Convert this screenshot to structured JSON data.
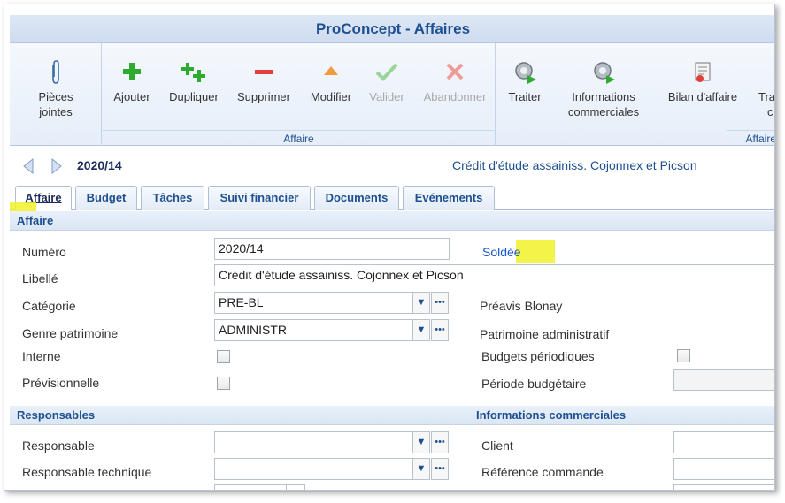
{
  "window": {
    "title": "ProConcept - Affaires"
  },
  "ribbon": {
    "attachments": {
      "label_line1": "Pièces",
      "label_line2": "jointes"
    },
    "group_affaire": {
      "label": "Affaire",
      "buttons": [
        {
          "label": "Ajouter",
          "icon": "plus-icon",
          "enabled": true
        },
        {
          "label": "Dupliquer",
          "icon": "duplicate-icon",
          "enabled": true
        },
        {
          "label": "Supprimer",
          "icon": "minus-icon",
          "enabled": true
        },
        {
          "label": "Modifier",
          "icon": "modify-icon",
          "enabled": true
        },
        {
          "label": "Valider",
          "icon": "check-icon",
          "enabled": false
        },
        {
          "label": "Abandonner",
          "icon": "x-icon",
          "enabled": false
        }
      ]
    },
    "group_affaire2": {
      "label": "Affaire",
      "buttons": [
        {
          "label": "Traiter",
          "icon": "process-gear-icon"
        },
        {
          "label_line1": "Informations",
          "label_line2": "commerciales",
          "icon": "info-gear-icon"
        },
        {
          "label": "Bilan d'affaire",
          "icon": "report-icon"
        },
        {
          "label_line1": "Tra",
          "label_line2": "c",
          "icon": "truncated-icon"
        }
      ]
    }
  },
  "record": {
    "number": "2020/14",
    "title": "Crédit d'étude assainiss. Cojonnex et Picson"
  },
  "tabs": [
    "Affaire",
    "Budget",
    "Tâches",
    "Suivi financier",
    "Documents",
    "Evénements"
  ],
  "section_affaire": {
    "header": "Affaire",
    "numero": {
      "label": "Numéro",
      "value": "2020/14",
      "status": "Soldée"
    },
    "libelle": {
      "label": "Libellé",
      "value": "Crédit d'étude assainiss. Cojonnex et Picson"
    },
    "categorie": {
      "label": "Catégorie",
      "value": "PRE-BL",
      "description": "Préavis Blonay"
    },
    "genre": {
      "label": "Genre patrimoine",
      "value": "ADMINISTR",
      "description": "Patrimoine administratif"
    },
    "interne": {
      "label": "Interne",
      "checked": false
    },
    "budgets_periodiques": {
      "label": "Budgets périodiques",
      "checked": false
    },
    "previsionnelle": {
      "label": "Prévisionnelle",
      "checked": false
    },
    "periode_budgetaire": {
      "label": "Période budgétaire",
      "value": ""
    }
  },
  "section_responsables": {
    "header": "Responsables",
    "responsable": {
      "label": "Responsable",
      "value": ""
    },
    "responsable_technique": {
      "label": "Responsable technique",
      "value": ""
    }
  },
  "section_info_commerciales": {
    "header": "Informations commerciales",
    "client": {
      "label": "Client",
      "value": ""
    },
    "reference_commande": {
      "label": "Référence commande",
      "value": ""
    }
  },
  "colors": {
    "accent": "#1d4f91",
    "highlight": "#f1f229",
    "link": "#1a57c8",
    "add_green": "#2eaa2e",
    "delete_red": "#e0403a"
  }
}
